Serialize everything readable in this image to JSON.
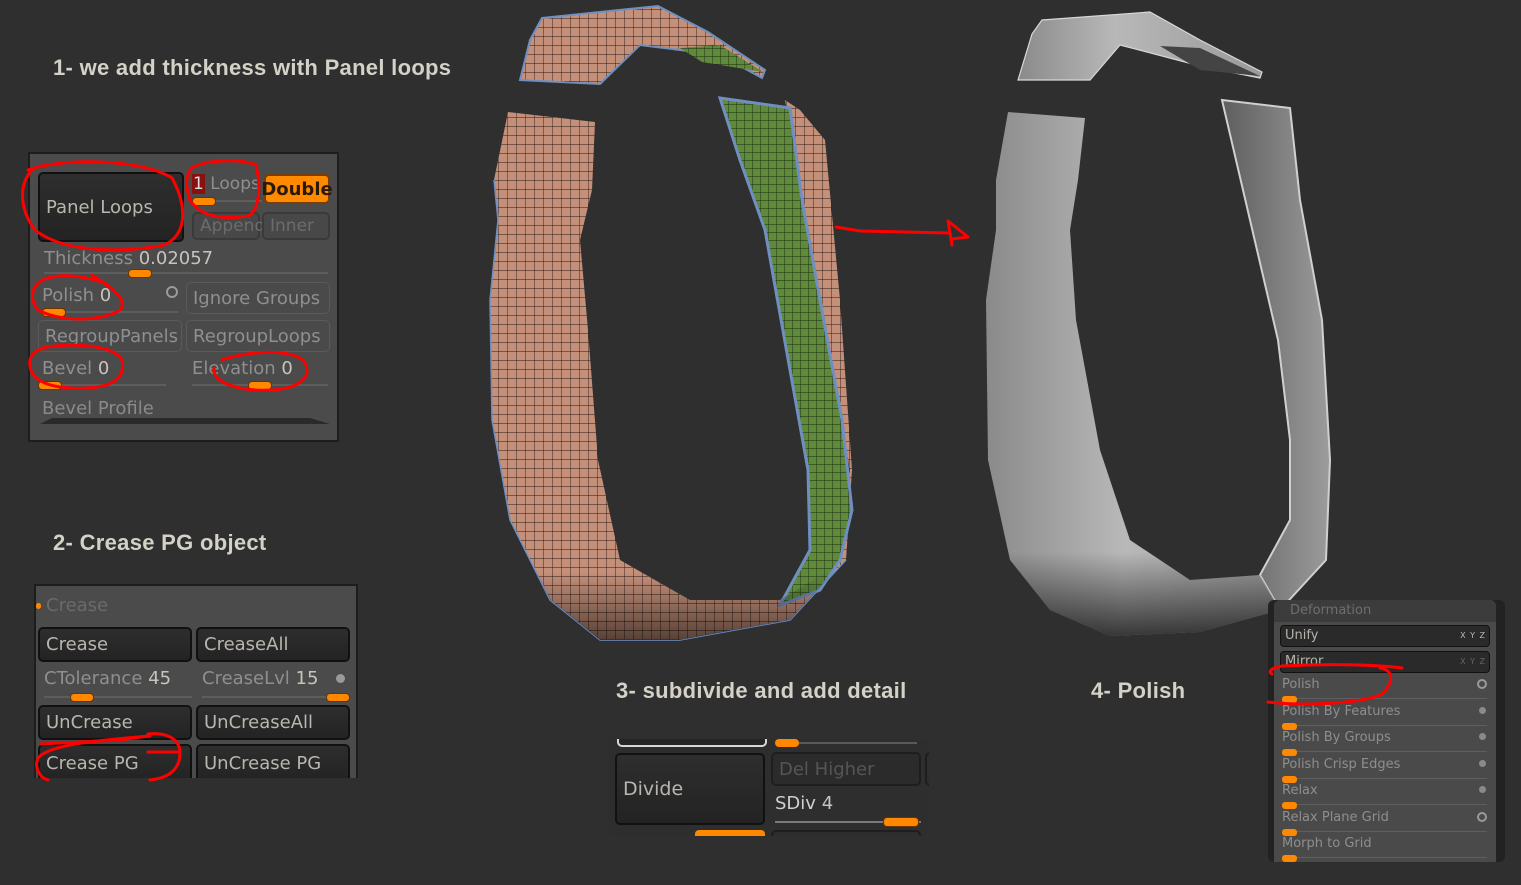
{
  "steps": {
    "step1": "1- we add thickness with Panel loops",
    "step2": "2- Crease PG object",
    "step3": "3- subdivide and add detail",
    "step4": "4- Polish"
  },
  "panel_loops": {
    "main_button": "Panel Loops",
    "loops_value": "1",
    "loops_label": "Loops",
    "double_button": "Double",
    "append_button": "Append",
    "inner_button": "Inner",
    "thickness_label": "Thickness",
    "thickness_value": "0.02057",
    "polish_label": "Polish",
    "polish_value": "0",
    "ignore_groups_button": "Ignore Groups",
    "regroup_panels_button": "RegroupPanels",
    "regroup_loops_button": "RegroupLoops",
    "bevel_label": "Bevel",
    "bevel_value": "0",
    "elevation_label": "Elevation",
    "elevation_value": "0",
    "bevel_profile_label": "Bevel Profile"
  },
  "crease": {
    "header": "Crease",
    "crease_button": "Crease",
    "crease_all_button": "CreaseAll",
    "ctolerance_label": "CTolerance",
    "ctolerance_value": "45",
    "creaselvl_label": "CreaseLvl",
    "creaselvl_value": "15",
    "uncrease_button": "UnCrease",
    "uncrease_all_button": "UnCreaseAll",
    "crease_pg_button": "Crease PG",
    "uncrease_pg_button": "UnCrease PG"
  },
  "subdivide": {
    "divide_button": "Divide",
    "del_higher_button": "Del Higher",
    "sdiv_label": "SDiv",
    "sdiv_value": "4"
  },
  "deformation": {
    "header": "Deformation",
    "xyz_label": "X Y Z",
    "unify_button": "Unify",
    "mirror_button": "Mirror",
    "sliders": [
      {
        "label": "Polish",
        "indicator": "ring"
      },
      {
        "label": "Polish By Features",
        "indicator": "dot"
      },
      {
        "label": "Polish By Groups",
        "indicator": "dot"
      },
      {
        "label": "Polish Crisp Edges",
        "indicator": "dot"
      },
      {
        "label": "Relax",
        "indicator": "dot"
      },
      {
        "label": "Relax Plane Grid",
        "indicator": "ring"
      },
      {
        "label": "Morph to Grid",
        "indicator": "none"
      }
    ]
  },
  "colors": {
    "background": "#2f2f2f",
    "accent_orange": "#ff8800",
    "annotation_red": "#ff0000",
    "mesh_skin": "#c4907a",
    "mesh_green": "#5e8a3a",
    "mesh_edge_blue": "#6f8fc0",
    "polished_grey": "#a8a8a8"
  }
}
